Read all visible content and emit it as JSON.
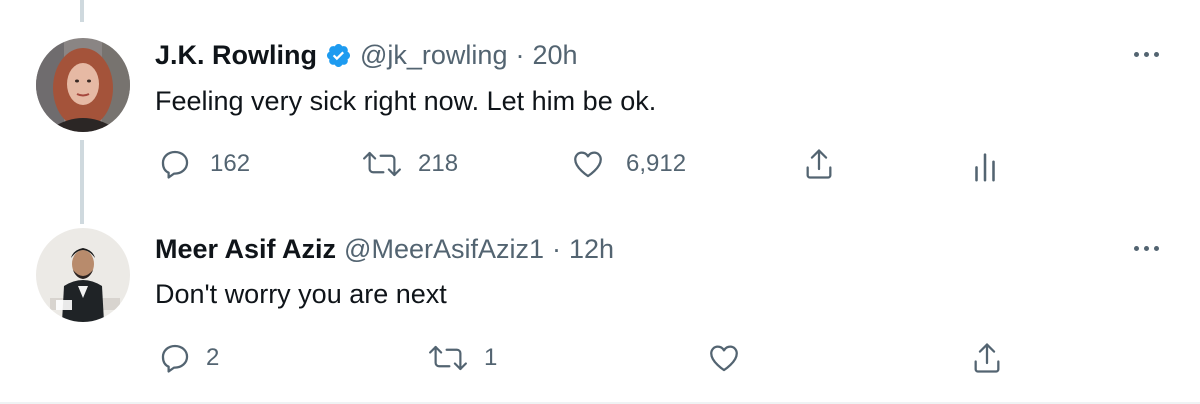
{
  "tweet": {
    "author_name": "J.K. Rowling",
    "handle": "@jk_rowling",
    "separator": "·",
    "time": "20h",
    "text": "Feeling very sick right now. Let him be ok.",
    "replies": "162",
    "retweets": "218",
    "likes": "6,912",
    "verified": true
  },
  "reply": {
    "author_name": "Meer Asif Aziz",
    "handle": "@MeerAsifAziz1",
    "separator": "·",
    "time": "12h",
    "text": "Don't worry you are next",
    "replies": "2",
    "retweets": "1",
    "likes": ""
  },
  "icons": {
    "reply": "reply-icon",
    "retweet": "retweet-icon",
    "like": "heart-icon",
    "share": "share-icon",
    "analytics": "analytics-icon",
    "more": "more-icon",
    "verified": "verified-badge-icon"
  },
  "colors": {
    "text": "#0f1419",
    "secondary": "#536471",
    "verified_blue": "#1d9bf0",
    "thread_line": "#cfd9de"
  }
}
